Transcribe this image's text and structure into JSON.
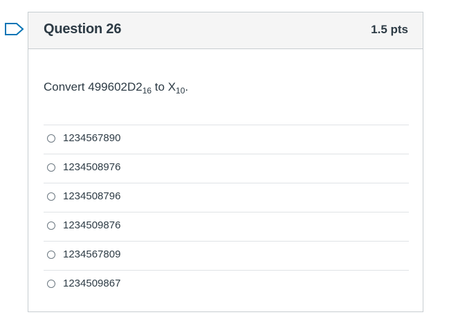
{
  "question": {
    "title": "Question 26",
    "points": "1.5 pts",
    "text_prefix": "Convert 499602D2",
    "text_sub1": "16",
    "text_mid": " to X",
    "text_sub2": "10",
    "text_suffix": "."
  },
  "flag": {
    "icon": "bookmark-flag-icon",
    "color": "#0374b5"
  },
  "answers": [
    {
      "label": "1234567890",
      "selected": false
    },
    {
      "label": "1234508976",
      "selected": false
    },
    {
      "label": "1234508796",
      "selected": false
    },
    {
      "label": "1234509876",
      "selected": false
    },
    {
      "label": "1234567809",
      "selected": false
    },
    {
      "label": "1234509867",
      "selected": false
    }
  ]
}
